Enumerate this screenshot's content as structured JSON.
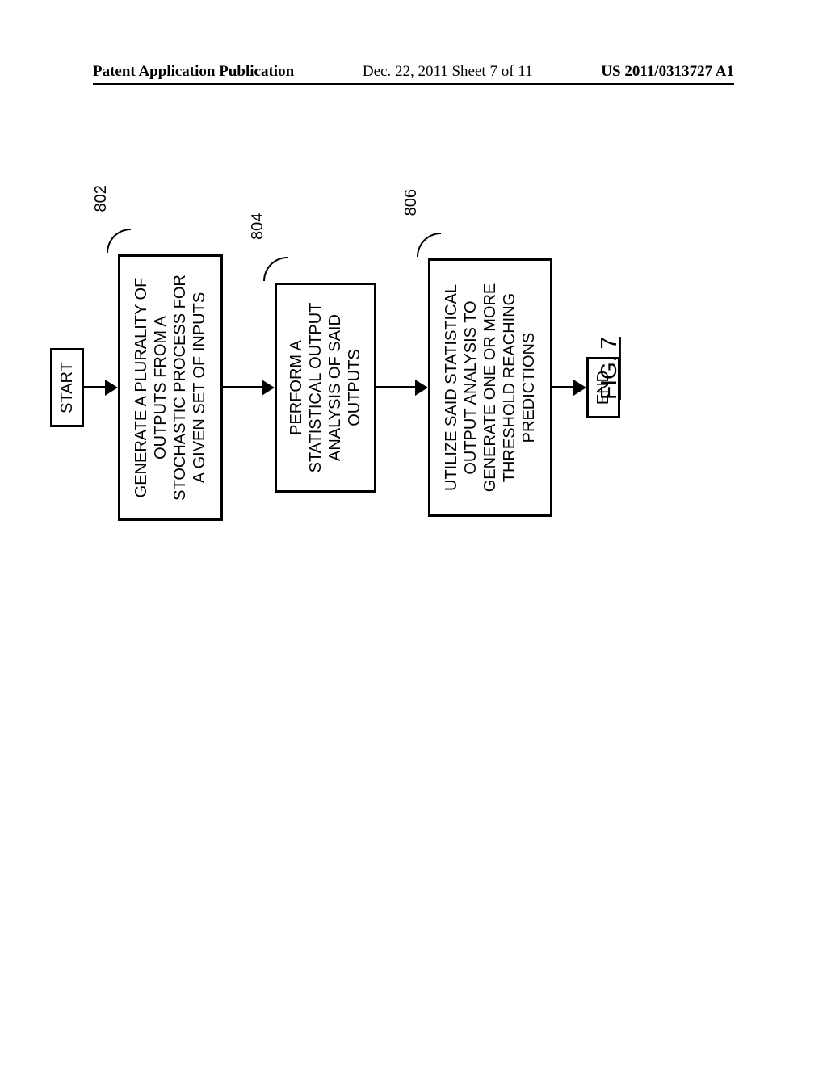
{
  "header": {
    "left": "Patent Application Publication",
    "center": "Dec. 22, 2011  Sheet 7 of 11",
    "right": "US 2011/0313727 A1"
  },
  "flowchart": {
    "start": "START",
    "end": "END",
    "steps": [
      {
        "ref": "802",
        "text": "GENERATE A PLURALITY OF\nOUTPUTS FROM A\nSTOCHASTIC PROCESS FOR\nA GIVEN SET OF INPUTS"
      },
      {
        "ref": "804",
        "text": "PERFORM A\nSTATISTICAL OUTPUT\nANALYSIS OF SAID\nOUTPUTS"
      },
      {
        "ref": "806",
        "text": "UTILIZE SAID STATISTICAL\nOUTPUT ANALYSIS TO\nGENERATE ONE OR MORE\nTHRESHOLD REACHING\nPREDICTIONS"
      }
    ]
  },
  "figure_label": "FIG. 7"
}
